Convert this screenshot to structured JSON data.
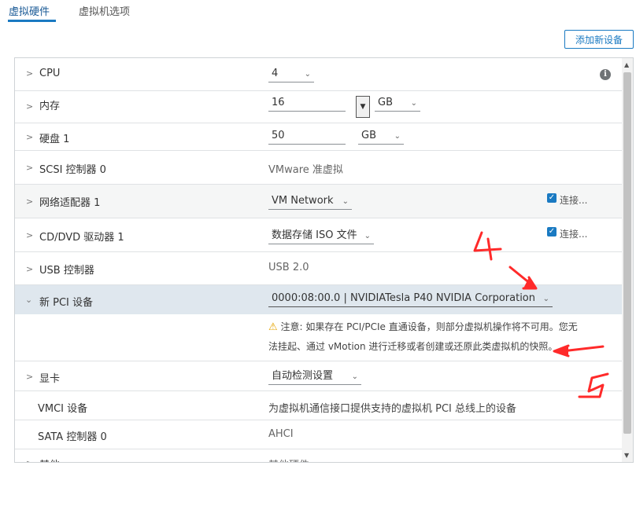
{
  "tabs": [
    "虚拟硬件",
    "虚拟机选项"
  ],
  "add_button": "添加新设备",
  "cpu": {
    "label": "CPU",
    "value": "4"
  },
  "memory": {
    "label": "内存",
    "value": "16",
    "unit": "GB"
  },
  "disk": {
    "label": "硬盘 1",
    "value": "50",
    "unit": "GB"
  },
  "scsi": {
    "label": "SCSI 控制器 0",
    "value": "VMware 准虚拟"
  },
  "network": {
    "label": "网络适配器 1",
    "value": "VM Network",
    "connect": "连接..."
  },
  "cdrom": {
    "label": "CD/DVD 驱动器 1",
    "value": "数据存储 ISO 文件",
    "connect": "连接..."
  },
  "usb": {
    "label": "USB 控制器",
    "value": "USB 2.0"
  },
  "pci": {
    "label": "新 PCI 设备",
    "value": "0000:08:00.0 | NVIDIATesla P40 NVIDIA Corporation",
    "warning_line1": "注意: 如果存在 PCI/PCIe 直通设备，则部分虚拟机操作将不可用。您无",
    "warning_line2": "法挂起、通过 vMotion 进行迁移或者创建或还原此类虚拟机的快照。"
  },
  "video": {
    "label": "显卡",
    "value": "自动检测设置"
  },
  "vmci": {
    "label": "VMCI 设备",
    "value": "为虚拟机通信接口提供支持的虚拟机 PCI 总线上的设备"
  },
  "sata": {
    "label": "SATA 控制器 0",
    "value": "AHCI"
  },
  "other": {
    "label": "其他",
    "value": "其他硬件"
  },
  "annotations": {
    "mark_a": "4",
    "mark_b": "5"
  },
  "colors": {
    "accent": "#1a7ac2",
    "annotation": "#ff2a2a",
    "selected_row": "#dfe7ee"
  }
}
